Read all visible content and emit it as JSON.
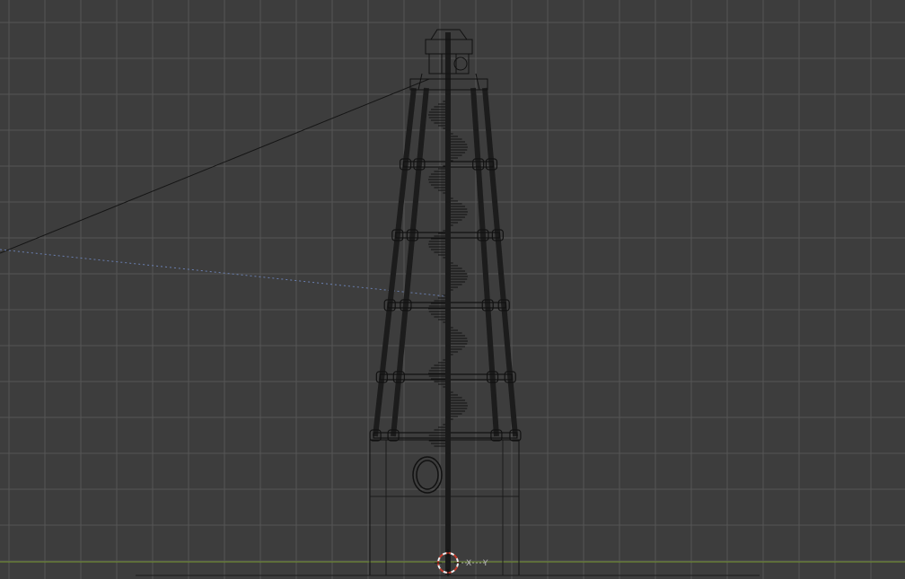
{
  "viewport": {
    "background": "#3d3d3d",
    "grid_color": "#555555",
    "wire_color": "#111111",
    "horizon_color": "#6e8f2a",
    "guide_color": "#6a7fb0",
    "cursor_colors": [
      "#c43a2b",
      "#f0f0f0"
    ]
  },
  "axis_gizmo": {
    "x_label": "X",
    "y_label": "Y"
  },
  "icons": {
    "cursor": "3d-cursor-icon",
    "tower": "lighthouse-wireframe"
  }
}
